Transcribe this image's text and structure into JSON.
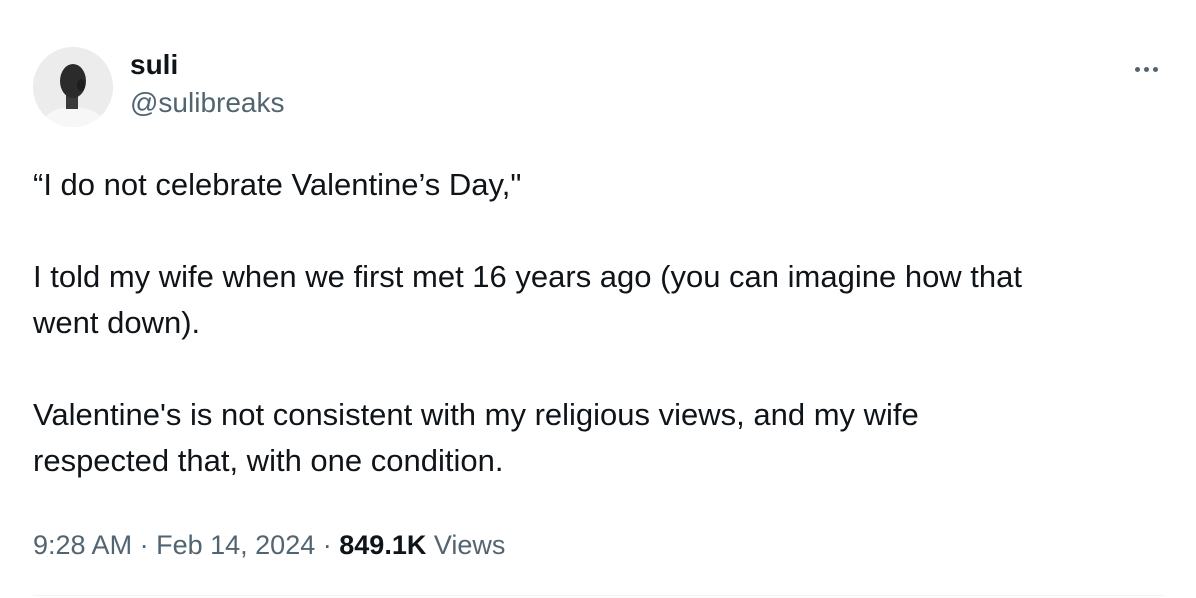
{
  "author": {
    "display_name": "suli",
    "handle": "@sulibreaks"
  },
  "tweet": {
    "paragraphs": [
      [
        "“I do not celebrate Valentine’s Day,\""
      ],
      [
        "I told my wife when we first met 16 years ago (you can imagine how that",
        "went down)."
      ],
      [
        "Valentine's is not consistent with my religious views, and my wife",
        "respected that, with one condition."
      ]
    ],
    "time": "9:28 AM",
    "separator": "·",
    "date": "Feb 14, 2024",
    "views_count": "849.1K",
    "views_label": "Views"
  },
  "icons": {
    "more": "more-horizontal-icon"
  },
  "colors": {
    "text_primary": "#0f1419",
    "text_secondary": "#536471",
    "divider": "#eff3f4"
  }
}
